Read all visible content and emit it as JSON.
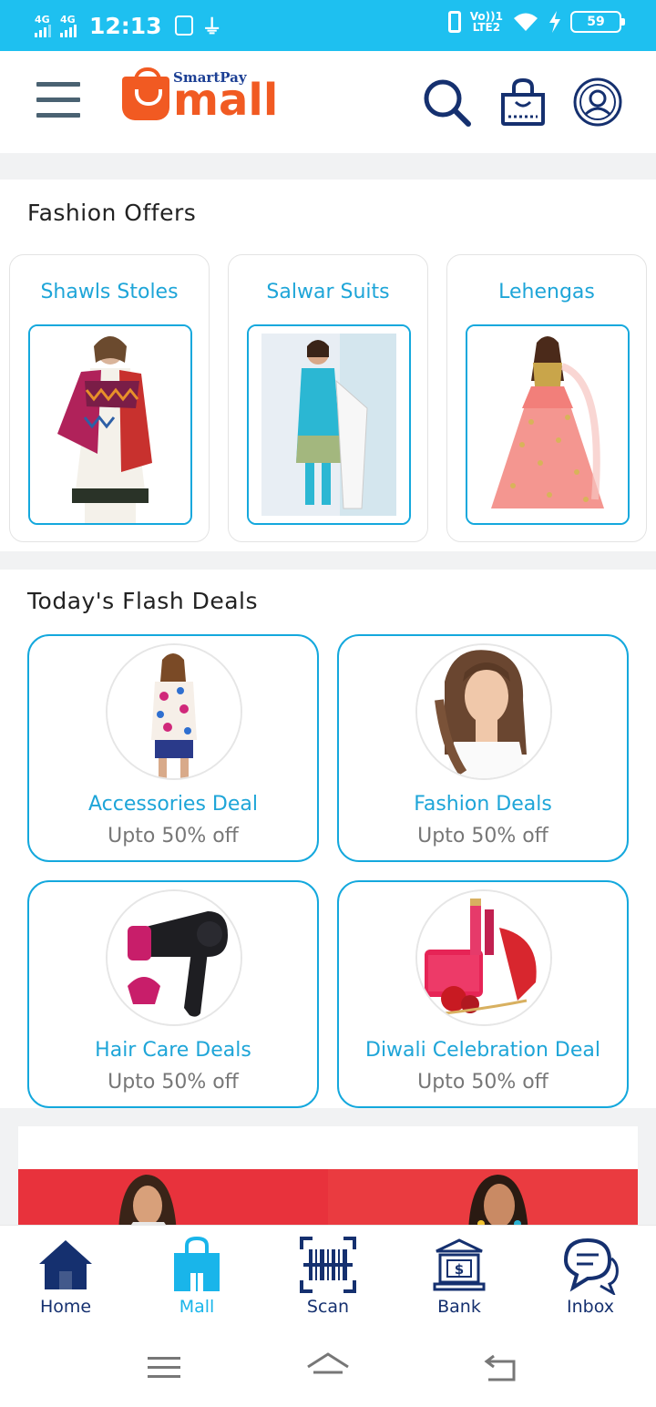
{
  "status_bar": {
    "network_1": "4G",
    "network_2": "4G",
    "time": "12:13",
    "volte": "Vo))1",
    "lte": "LTE2",
    "battery": "59"
  },
  "header": {
    "brand_small": "SmartPay",
    "brand_main": "mall",
    "icons": [
      "menu-icon",
      "search-icon",
      "shopping-bag-icon",
      "profile-icon"
    ]
  },
  "fashion_offers": {
    "title": "Fashion Offers",
    "items": [
      {
        "label": "Shawls Stoles"
      },
      {
        "label": "Salwar Suits"
      },
      {
        "label": "Lehengas"
      }
    ]
  },
  "flash_deals": {
    "title": "Today's Flash Deals",
    "items": [
      {
        "name": "Accessories Deal",
        "sub": "Upto 50% off"
      },
      {
        "name": "Fashion Deals",
        "sub": "Upto 50% off"
      },
      {
        "name": "Hair Care Deals",
        "sub": "Upto 50% off"
      },
      {
        "name": "Diwali Celebration Deal",
        "sub": "Upto 50% off"
      }
    ]
  },
  "bottom_nav": {
    "active": "Mall",
    "items": [
      {
        "label": "Home",
        "icon": "home-icon"
      },
      {
        "label": "Mall",
        "icon": "mall-bag-icon"
      },
      {
        "label": "Scan",
        "icon": "barcode-scan-icon"
      },
      {
        "label": "Bank",
        "icon": "bank-icon"
      },
      {
        "label": "Inbox",
        "icon": "chat-icon"
      }
    ]
  },
  "colors": {
    "status_bar": "#1ec0f0",
    "brand_orange": "#f15a22",
    "accent_blue": "#14a8dd",
    "nav_dark": "#15306f"
  }
}
